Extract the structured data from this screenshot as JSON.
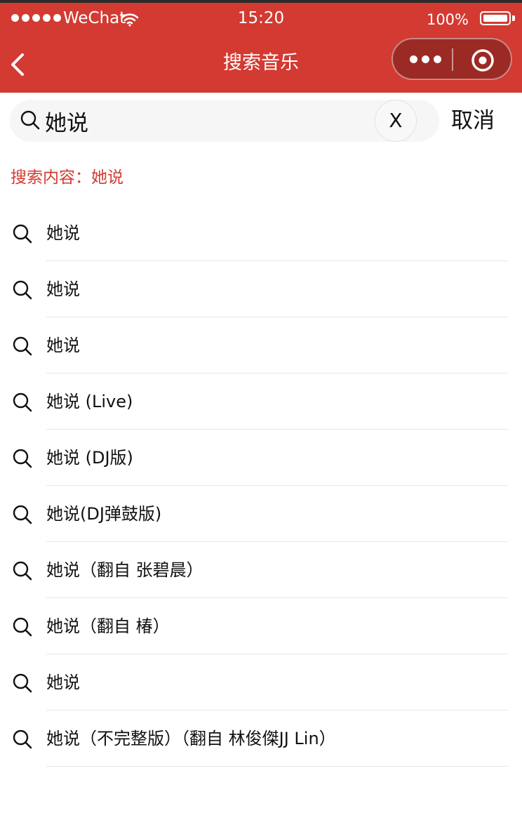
{
  "status_bar": {
    "carrier": "WeChat",
    "time": "15:20",
    "battery": "100%"
  },
  "nav": {
    "title": "搜索音乐"
  },
  "search": {
    "value": "她说",
    "clear_label": "X",
    "cancel_label": "取消"
  },
  "query_label": "搜索内容：她说",
  "results": [
    "她说",
    "她说",
    "她说",
    "她说 (Live)",
    "她说 (DJ版)",
    "她说(DJ弹鼓版)",
    "她说（翻自 张碧晨）",
    "她说（翻自 椿）",
    "她说",
    "她说（不完整版）（翻自 林俊傑JJ Lin）"
  ],
  "colors": {
    "accent": "#d33a31",
    "capsule": "#9c2a24"
  },
  "icons": [
    "back-icon",
    "more-icon",
    "target-icon",
    "search-icon",
    "wifi-icon",
    "battery-icon"
  ]
}
